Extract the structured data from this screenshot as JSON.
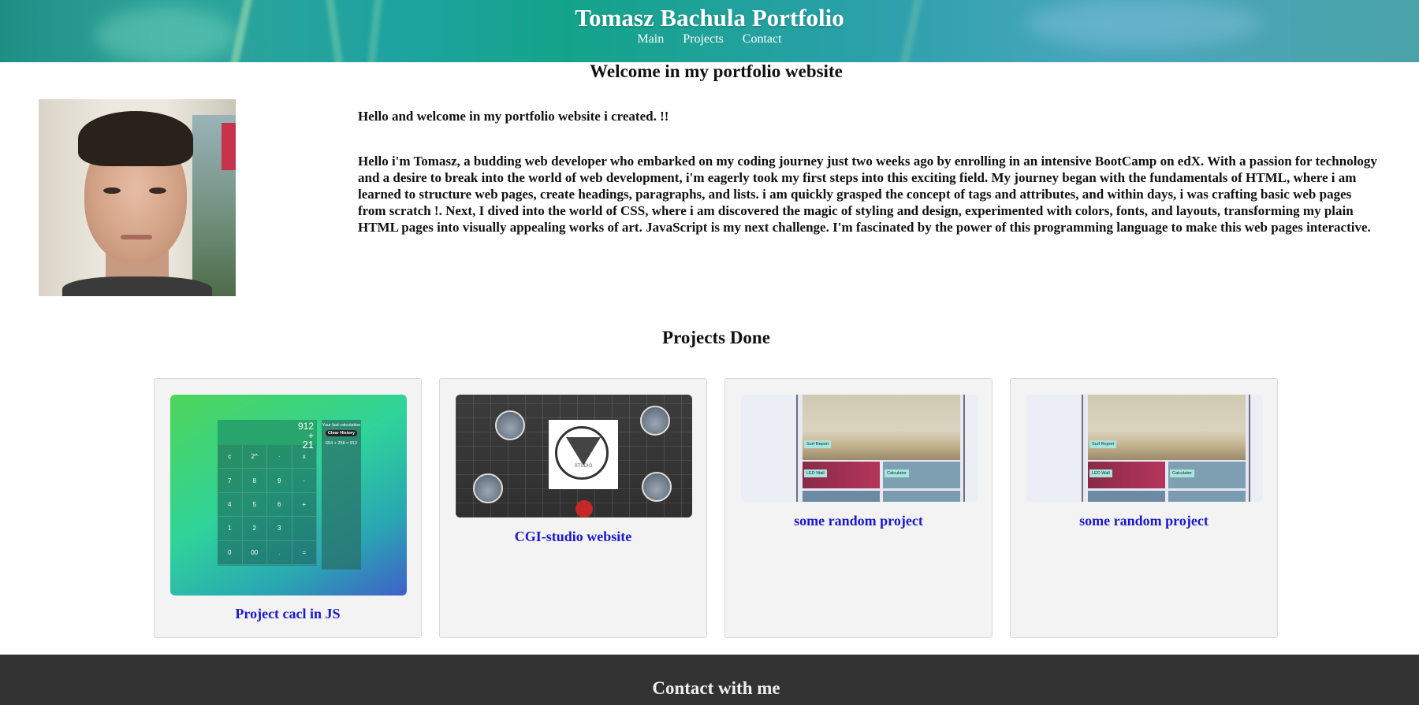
{
  "header": {
    "title": "Tomasz Bachula Portfolio",
    "nav": [
      {
        "label": "Main"
      },
      {
        "label": "Projects"
      },
      {
        "label": "Contact"
      }
    ]
  },
  "welcome": {
    "heading": "Welcome in my portfolio website",
    "intro": "Hello and welcome in my portfolio website i created. !!",
    "bio": "Hello i'm Tomasz, a budding web developer who embarked on my coding journey just two weeks ago by enrolling in an intensive BootCamp on edX. With a passion for technology and a desire to break into the world of web development, i'm eagerly took my first steps into this exciting field. My journey began with the fundamentals of HTML, where i am learned to structure web pages, create headings, paragraphs, and lists. i am quickly grasped the concept of tags and attributes, and within days, i was crafting basic web pages from scratch !. Next, I dived into the world of CSS, where i am discovered the magic of styling and design, experimented with colors, fonts, and layouts, transforming my plain HTML pages into visually appealing works of art. JavaScript is my next challenge. I'm fascinated by the power of this programming language to make this web pages interactive."
  },
  "projects": {
    "heading": "Projects Done",
    "items": [
      {
        "caption": "Project cacl in JS",
        "thumb": "calculator-screenshot"
      },
      {
        "caption": "CGI-studio website",
        "thumb": "cgi-studio-screenshot"
      },
      {
        "caption": "some random project",
        "thumb": "random-project-screenshot"
      },
      {
        "caption": "some random project",
        "thumb": "random-project-screenshot"
      }
    ]
  },
  "calc_thumb": {
    "display_top": "912",
    "display_op": "+",
    "display_value": "21",
    "history_title": "Your last calculation",
    "clear_label": "Clear History",
    "history_entry": "654 + 258 = 912",
    "keys": [
      "c",
      "2^",
      "·",
      "x",
      "7",
      "8",
      "9",
      "-",
      "4",
      "5",
      "6",
      "+",
      "1",
      "2",
      "3",
      "",
      "0",
      "00",
      ".",
      "="
    ]
  },
  "cgi_thumb": {
    "logo_text": "STUDIO"
  },
  "rand_thumb": {
    "label1": "Surf Report",
    "label2": "LED Wall",
    "label3": "Calculator"
  },
  "footer": {
    "heading": "Contact with me"
  },
  "colors": {
    "link": "#1a1acc",
    "footer_bg": "#333333",
    "card_bg": "#f3f3f3"
  }
}
